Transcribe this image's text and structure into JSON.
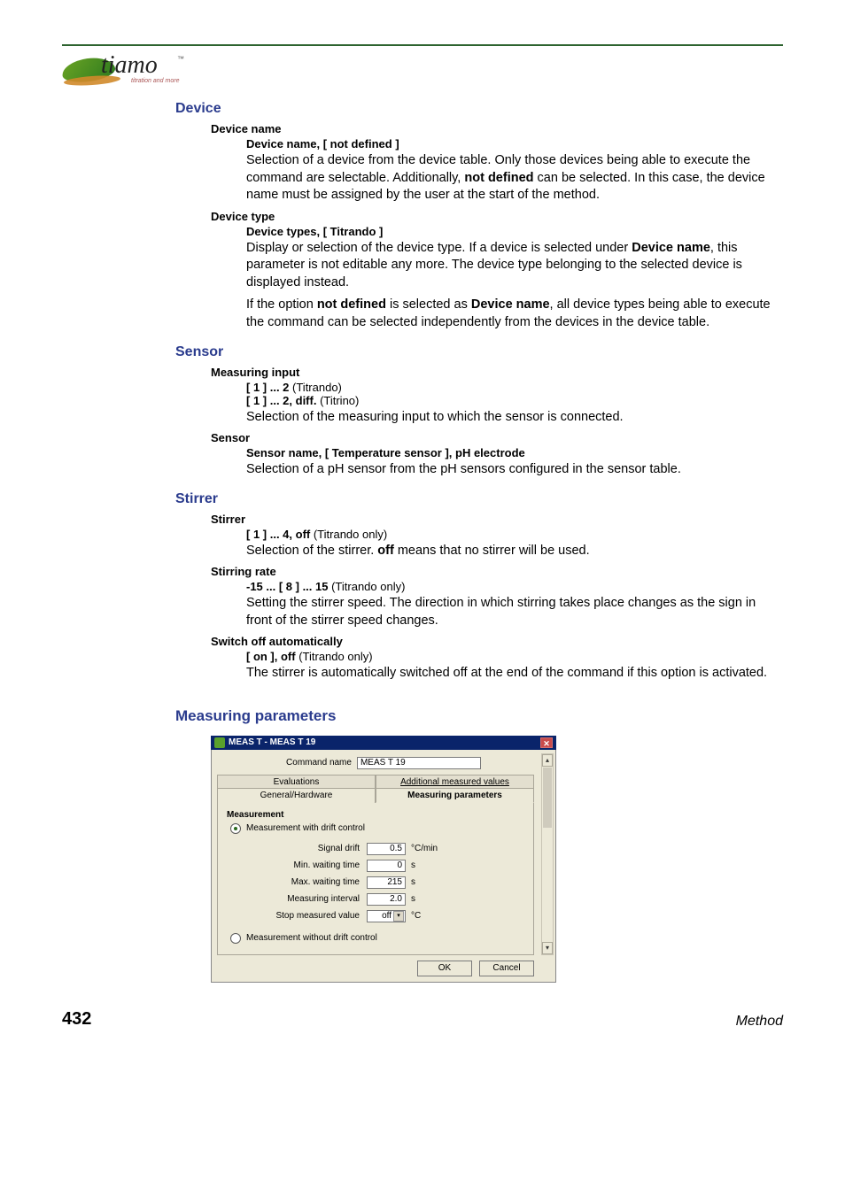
{
  "logo": {
    "name": "tiamo",
    "tm": "™",
    "tag": "titration and more"
  },
  "sections": {
    "device": {
      "heading": "Device",
      "name_title": "Device name",
      "name_value": "Device name, [ not defined ]",
      "name_body": "Selection of a device from the device table. Only those devices being able to execute the command are selectable. Additionally, ",
      "name_body_bold": "not defined",
      "name_body_tail": " can be selected. In this case, the device name must be assigned by the user at the start of the method.",
      "type_title": "Device type",
      "type_value": "Device types, [ Titrando ]",
      "type_body_a": "Display or selection of the device type. If a device is selected under ",
      "type_body_a_bold": "Device name",
      "type_body_a_tail": ", this parameter is not editable any more. The device type belonging to the selected device is displayed instead.",
      "type_body_b_pre": "If the option ",
      "type_body_b_bold1": "not defined",
      "type_body_b_mid": " is selected as ",
      "type_body_b_bold2": "Device name",
      "type_body_b_tail": ", all device types being able to execute the command can be selected independently from the devices in the device table."
    },
    "sensor": {
      "heading": "Sensor",
      "mi_title": "Measuring input",
      "mi_v1_bold": "[ 1 ] ... 2",
      "mi_v1_tail": " (Titrando)",
      "mi_v2_bold": "[ 1 ] ... 2, diff.",
      "mi_v2_tail": " (Titrino)",
      "mi_body": "Selection of the measuring input to which the sensor is connected.",
      "s_title": "Sensor",
      "s_value": "Sensor name, [ Temperature sensor ], pH electrode",
      "s_body": "Selection of a pH sensor from the pH sensors configured in the sensor table."
    },
    "stirrer": {
      "heading": "Stirrer",
      "s_title": "Stirrer",
      "s_value_bold": "[ 1 ] ... 4, off",
      "s_value_tail": " (Titrando only)",
      "s_body_a": "Selection of the stirrer. ",
      "s_body_bold": "off",
      "s_body_b": " means that no stirrer will be used.",
      "r_title": "Stirring rate",
      "r_value_bold": "-15 ... [ 8 ] ... 15",
      "r_value_tail": " (Titrando only)",
      "r_body": "Setting the stirrer speed. The direction in which stirring takes place changes as the sign in front of the stirrer speed changes.",
      "a_title": "Switch off automatically",
      "a_value_bold": "[ on ], off",
      "a_value_tail": " (Titrando only)",
      "a_body": "The stirrer is automatically switched off at the end of the command if this option is activated."
    },
    "measparam": {
      "heading": "Measuring parameters"
    }
  },
  "dialog": {
    "title": "MEAS T - MEAS T 19",
    "close": "✕",
    "cmd_label": "Command name",
    "cmd_value": "MEAS T 19",
    "tabs_top": {
      "evaluations": "Evaluations",
      "additional": "Additional measured values"
    },
    "tabs_bottom": {
      "general": "General/Hardware",
      "measuring": "Measuring parameters"
    },
    "group": "Measurement",
    "radio_with": "Measurement with drift control",
    "radio_without": "Measurement without drift control",
    "fields": {
      "signal_drift": {
        "label": "Signal drift",
        "value": "0.5",
        "unit": "°C/min"
      },
      "min_wait": {
        "label": "Min. waiting time",
        "value": "0",
        "unit": "s"
      },
      "max_wait": {
        "label": "Max. waiting time",
        "value": "215",
        "unit": "s"
      },
      "interval": {
        "label": "Measuring interval",
        "value": "2.0",
        "unit": "s"
      },
      "stop": {
        "label": "Stop measured value",
        "value": "off",
        "unit": "°C"
      }
    },
    "buttons": {
      "ok": "OK",
      "cancel": "Cancel"
    },
    "scroll": {
      "up": "▴",
      "down": "▾"
    }
  },
  "footer": {
    "page": "432",
    "section": "Method"
  }
}
